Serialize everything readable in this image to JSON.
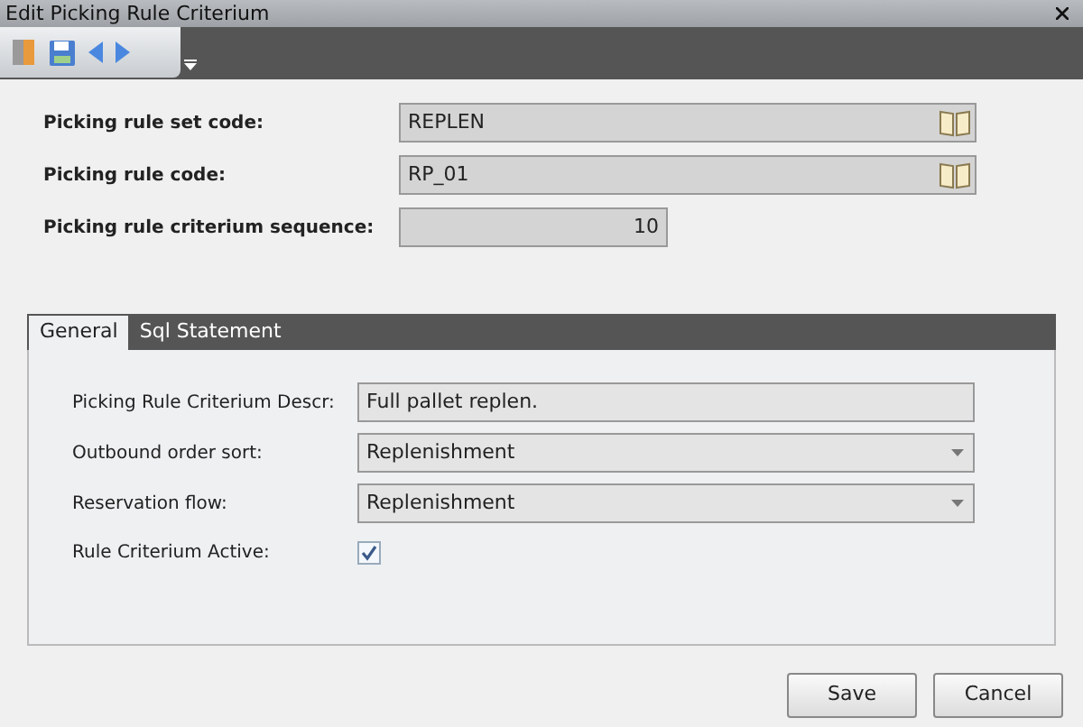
{
  "window": {
    "title": "Edit Picking Rule Criterium"
  },
  "header_fields": [
    {
      "label": "Picking rule set code:",
      "value": "REPLEN",
      "kind": "lookup"
    },
    {
      "label": "Picking rule code:",
      "value": "RP_01",
      "kind": "lookup"
    },
    {
      "label": "Picking rule criterium sequence:",
      "value": "10",
      "kind": "number"
    }
  ],
  "tabs": [
    {
      "label": "General",
      "selected": true
    },
    {
      "label": "Sql Statement",
      "selected": false
    }
  ],
  "form": [
    {
      "label": "Picking Rule Criterium Descr:",
      "value": "Full pallet replen.",
      "kind": "text"
    },
    {
      "label": "Outbound order sort:",
      "value": "Replenishment",
      "kind": "select"
    },
    {
      "label": "Reservation flow:",
      "value": "Replenishment",
      "kind": "select"
    },
    {
      "label": "Rule Criterium Active:",
      "kind": "checkbox",
      "checked": true
    }
  ],
  "buttons": [
    "Save",
    "Cancel"
  ]
}
